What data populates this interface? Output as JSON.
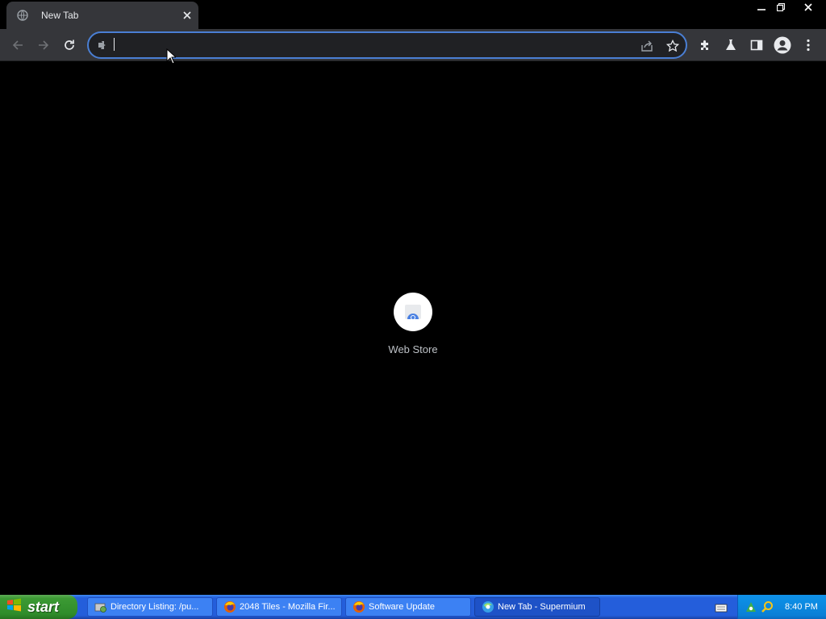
{
  "browser": {
    "tab": {
      "title": "New Tab",
      "favicon": "globe-icon"
    },
    "window_controls": [
      "minimize-icon",
      "restore-icon",
      "close-icon"
    ],
    "toolbar": {
      "buttons": [
        "back-arrow-icon",
        "forward-arrow-icon",
        "reload-icon"
      ],
      "omnibox": {
        "value": "",
        "placeholder": "",
        "site_icon": "extension-page-icon"
      },
      "right_icons": [
        "share-icon",
        "star-icon",
        "puzzle-extensions-icon",
        "flask-labs-icon",
        "side-panel-icon",
        "profile-avatar-icon",
        "kebab-menu-icon"
      ]
    }
  },
  "new_tab_page": {
    "shortcuts": [
      {
        "label": "Web Store",
        "icon": "web-store-icon"
      }
    ]
  },
  "taskbar": {
    "start_label": "start",
    "tasks": [
      {
        "label": "Directory Listing: /pu...",
        "icon": "network-folder-icon"
      },
      {
        "label": "2048 Tiles - Mozilla Fir...",
        "icon": "firefox-icon"
      },
      {
        "label": "Software Update",
        "icon": "firefox-icon"
      },
      {
        "label": "New Tab - Supermium",
        "icon": "supermium-icon",
        "active": true
      }
    ],
    "tray": {
      "clock": "8:40 PM",
      "icons": [
        "network-icon",
        "search-icon"
      ]
    }
  },
  "colors": {
    "tab_strip": "#000000",
    "toolbar": "#35363a",
    "omnibox_border": "#4a7fd4",
    "page_background": "#000000",
    "taskbar": "#245edb",
    "start_button": "#3c9a34"
  }
}
